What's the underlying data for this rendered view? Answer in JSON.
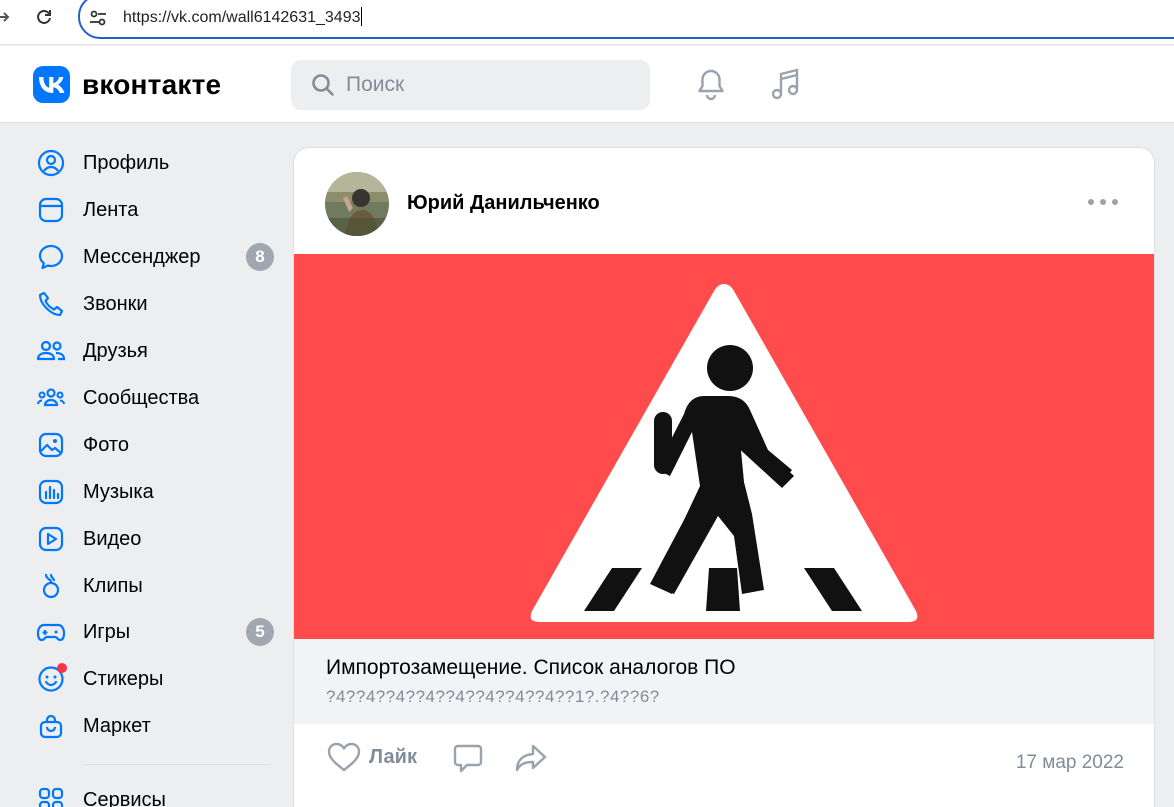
{
  "browser": {
    "url": "https://vk.com/wall6142631_3493"
  },
  "header": {
    "logo_text": "вконтакте",
    "search_placeholder": "Поиск"
  },
  "sidebar": {
    "items": [
      {
        "label": "Профиль",
        "icon": "profile-icon"
      },
      {
        "label": "Лента",
        "icon": "feed-icon"
      },
      {
        "label": "Мессенджер",
        "icon": "messenger-icon",
        "badge": "8"
      },
      {
        "label": "Звонки",
        "icon": "phone-icon"
      },
      {
        "label": "Друзья",
        "icon": "friends-icon"
      },
      {
        "label": "Сообщества",
        "icon": "communities-icon"
      },
      {
        "label": "Фото",
        "icon": "photo-icon"
      },
      {
        "label": "Музыка",
        "icon": "music-icon"
      },
      {
        "label": "Видео",
        "icon": "video-icon"
      },
      {
        "label": "Клипы",
        "icon": "clips-icon"
      },
      {
        "label": "Игры",
        "icon": "games-icon",
        "badge": "5"
      },
      {
        "label": "Стикеры",
        "icon": "stickers-icon"
      },
      {
        "label": "Маркет",
        "icon": "market-icon"
      },
      {
        "label": "Сервисы",
        "icon": "services-icon"
      }
    ]
  },
  "post": {
    "author": "Юрий Данильченко",
    "link_title": "Импортозамещение. Список аналогов ПО",
    "link_subtitle": "?4??4??4??4??4??4??4??4??1?.?4??6?",
    "like_label": "Лайк",
    "date": "17 мар 2022"
  },
  "colors": {
    "accent": "#0077ff",
    "image_background": "#ff4b4b",
    "secondary_text": "#818c99"
  }
}
